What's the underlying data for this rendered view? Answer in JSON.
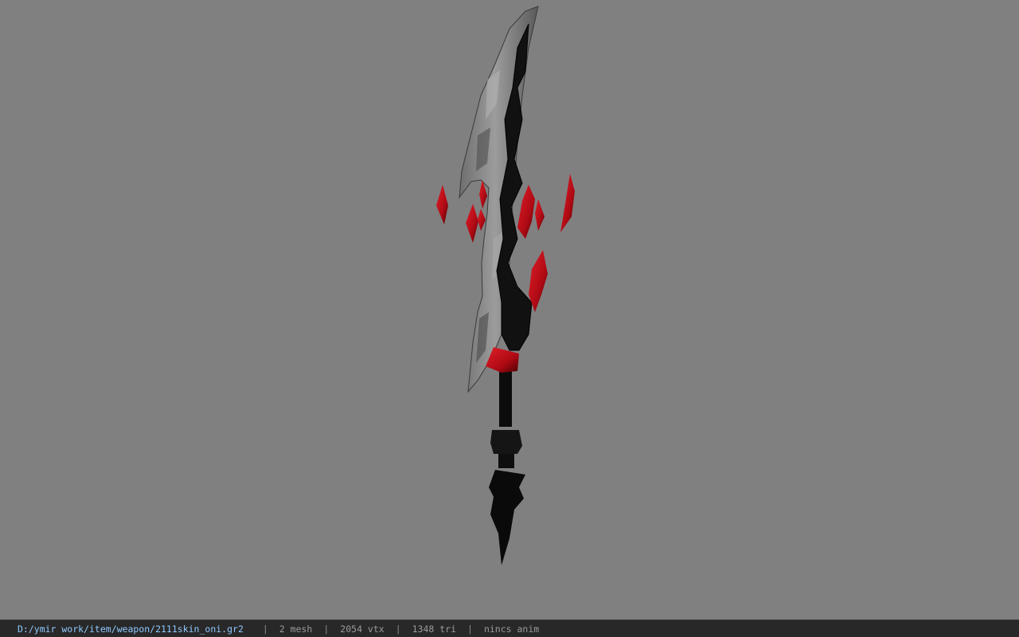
{
  "statusbar": {
    "file_path": "D:/ymir work/item/weapon/2111skin_oni.gr2",
    "separator": "|",
    "mesh_count": "2 mesh",
    "vertex_count": "2054 vtx",
    "triangle_count": "1348 tri",
    "anim": "nincs anim"
  },
  "viewport": {
    "background": "#808080",
    "model": "sword-3d-model"
  },
  "colors": {
    "blade": "#8c8c8c",
    "blade_dark": "#5e5e5e",
    "hilt": "#0c0c0c",
    "crystal": "#c8101a",
    "crystal_dark": "#5a0006",
    "status_bg": "#282828",
    "path_text": "#8fc8ff"
  }
}
